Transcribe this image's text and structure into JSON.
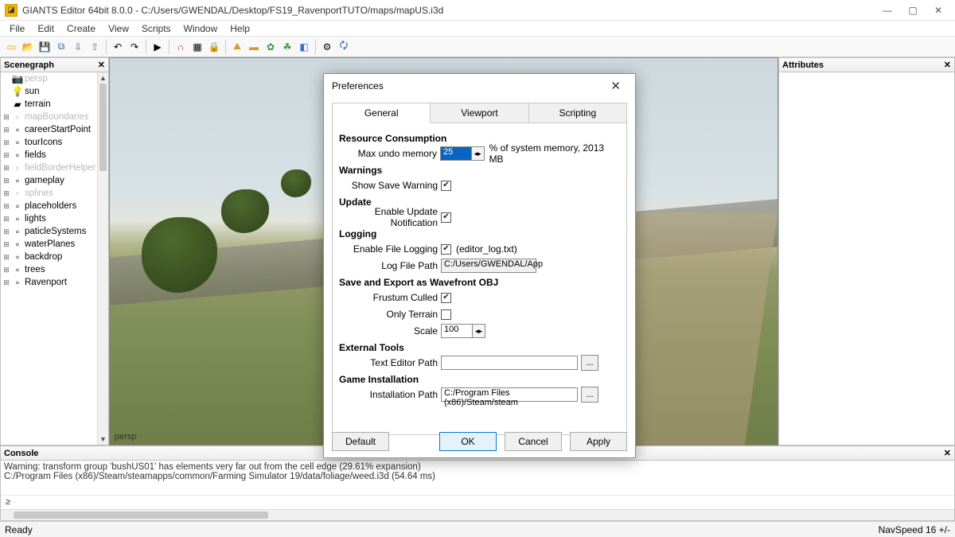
{
  "titlebar": {
    "title": "GIANTS Editor 64bit 8.0.0 - C:/Users/GWENDAL/Desktop/FS19_RavenportTUTO/maps/mapUS.i3d"
  },
  "menu": {
    "items": [
      "File",
      "Edit",
      "Create",
      "View",
      "Scripts",
      "Window",
      "Help"
    ]
  },
  "panels": {
    "scenegraph_title": "Scenegraph",
    "attributes_title": "Attributes",
    "console_title": "Console"
  },
  "viewport": {
    "camera_label": "persp"
  },
  "scenegraph": {
    "items": [
      {
        "label": "persp",
        "dim": true,
        "has_children": false,
        "icon": "camera"
      },
      {
        "label": "sun",
        "dim": false,
        "has_children": false,
        "icon": "light"
      },
      {
        "label": "terrain",
        "dim": false,
        "has_children": false,
        "icon": "terrain"
      },
      {
        "label": "mapBoundaries",
        "dim": true,
        "has_children": true,
        "icon": "group"
      },
      {
        "label": "careerStartPoint",
        "dim": false,
        "has_children": true,
        "icon": "group"
      },
      {
        "label": "tourIcons",
        "dim": false,
        "has_children": true,
        "icon": "group"
      },
      {
        "label": "fields",
        "dim": false,
        "has_children": true,
        "icon": "group"
      },
      {
        "label": "fieldBorderHelper",
        "dim": true,
        "has_children": true,
        "icon": "group"
      },
      {
        "label": "gameplay",
        "dim": false,
        "has_children": true,
        "icon": "group"
      },
      {
        "label": "splines",
        "dim": true,
        "has_children": true,
        "icon": "group"
      },
      {
        "label": "placeholders",
        "dim": false,
        "has_children": true,
        "icon": "group"
      },
      {
        "label": "lights",
        "dim": false,
        "has_children": true,
        "icon": "group"
      },
      {
        "label": "paticleSystems",
        "dim": false,
        "has_children": true,
        "icon": "group"
      },
      {
        "label": "waterPlanes",
        "dim": false,
        "has_children": true,
        "icon": "group"
      },
      {
        "label": "backdrop",
        "dim": false,
        "has_children": true,
        "icon": "group"
      },
      {
        "label": "trees",
        "dim": false,
        "has_children": true,
        "icon": "group"
      },
      {
        "label": "Ravenport",
        "dim": false,
        "has_children": true,
        "icon": "group"
      }
    ]
  },
  "console": {
    "line1": "Warning: transform group 'bushUS01' has elements very far out from the cell edge (29.61% expansion)",
    "line2": "C:/Program Files (x86)/Steam/steamapps/common/Farming Simulator 19/data/foliage/weed.i3d (54.64 ms)",
    "prompt": "≥"
  },
  "status": {
    "ready": "Ready",
    "navspeed": "NavSpeed 16 +/-"
  },
  "dialog": {
    "title": "Preferences",
    "tabs": {
      "general": "General",
      "viewport": "Viewport",
      "scripting": "Scripting"
    },
    "sections": {
      "resource": "Resource Consumption",
      "warnings": "Warnings",
      "update": "Update",
      "logging": "Logging",
      "obj": "Save and Export as Wavefront OBJ",
      "tools": "External Tools",
      "game": "Game Installation"
    },
    "labels": {
      "max_undo": "Max undo memory",
      "undo_suffix": "% of system memory,    2013 MB",
      "save_warning": "Show Save Warning",
      "update_notif": "Enable Update Notification",
      "file_logging": "Enable File Logging",
      "log_hint": "(editor_log.txt)",
      "log_path": "Log File Path",
      "frustum": "Frustum Culled",
      "only_terrain": "Only Terrain",
      "scale": "Scale",
      "text_editor": "Text Editor Path",
      "install_path": "Installation Path"
    },
    "values": {
      "max_undo": "25",
      "log_path": "C:/Users/GWENDAL/App",
      "scale": "100",
      "text_editor": "",
      "install_path": "C:/Program Files (x86)/Steam/steam"
    },
    "buttons": {
      "default": "Default",
      "ok": "OK",
      "cancel": "Cancel",
      "apply": "Apply",
      "browse": "..."
    }
  }
}
